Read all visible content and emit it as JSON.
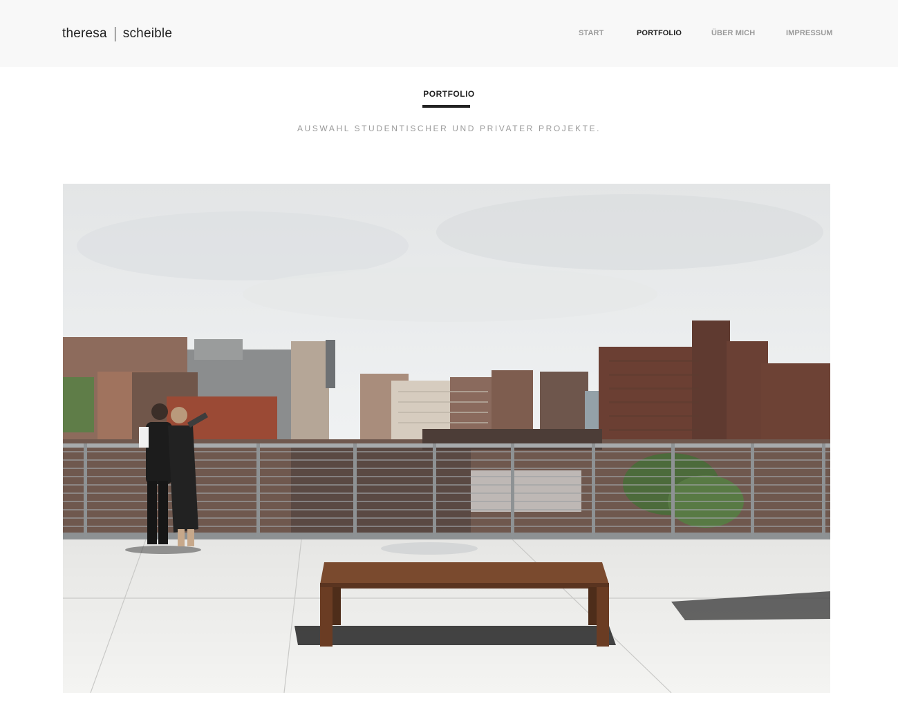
{
  "site": {
    "logo_first": "theresa",
    "logo_second": "scheible"
  },
  "nav": {
    "items": [
      {
        "label": "START",
        "active": false
      },
      {
        "label": "PORTFOLIO",
        "active": true
      },
      {
        "label": "ÜBER MICH",
        "active": false
      },
      {
        "label": "IMPRESSUM",
        "active": false
      }
    ]
  },
  "section": {
    "title": "PORTFOLIO",
    "subtitle": "AUSWAHL STUDENTISCHER UND PRIVATER PROJEKTE."
  },
  "colors": {
    "header_bg": "#f8f8f8",
    "text_dark": "#222222",
    "text_muted": "#9a9a9a"
  },
  "hero_image": {
    "icon": "rooftop-city-photo"
  }
}
